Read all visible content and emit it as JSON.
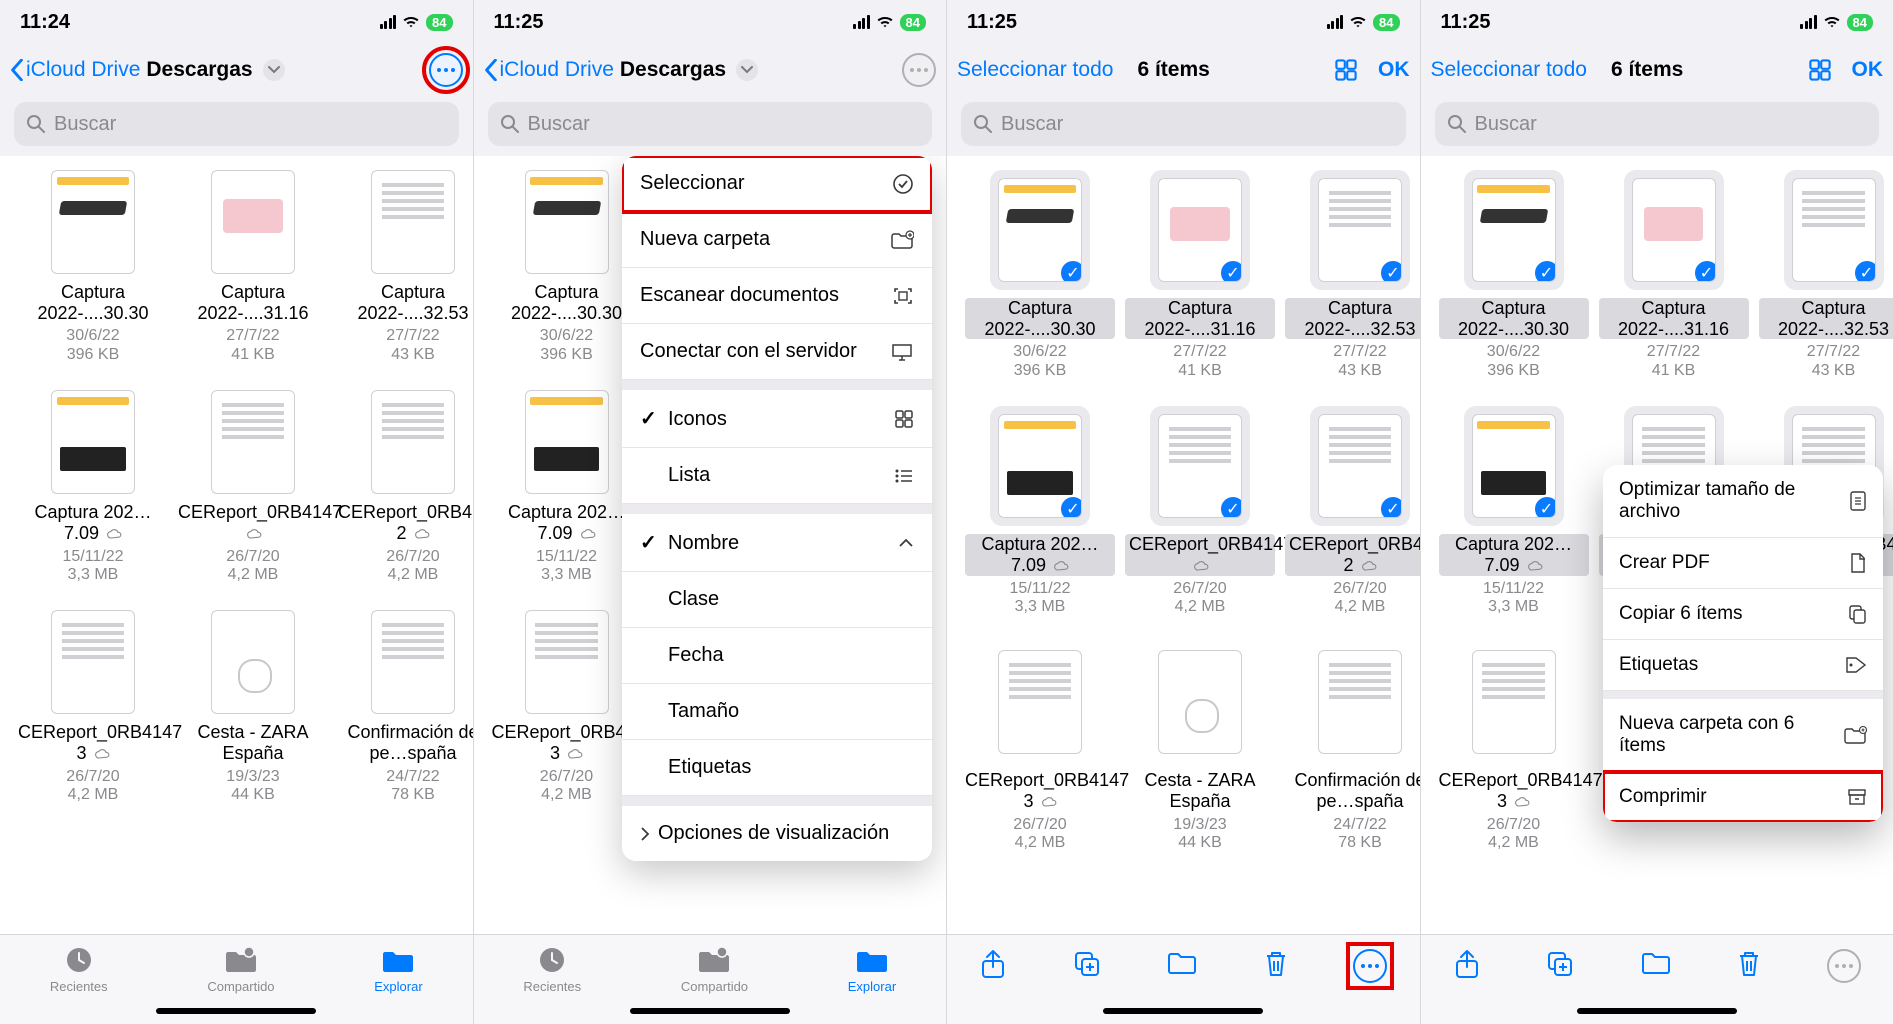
{
  "status": {
    "time1": "11:24",
    "time2": "11:25",
    "battery": "84"
  },
  "nav": {
    "back_label": "iCloud Drive",
    "folder": "Descargas",
    "select_all": "Seleccionar todo",
    "count": "6 ítems",
    "ok": "OK"
  },
  "search": {
    "placeholder": "Buscar"
  },
  "files": [
    {
      "name": "Captura 2022-....30.30",
      "date": "30/6/22",
      "size": "396 KB",
      "thumb": "hw"
    },
    {
      "name": "Captura 2022-....31.16",
      "date": "27/7/22",
      "size": "41 KB",
      "thumb": "pink"
    },
    {
      "name": "Captura 2022-....32.53",
      "date": "27/7/22",
      "size": "43 KB",
      "thumb": "blue"
    },
    {
      "name": "Captura 202…7.09",
      "date": "15/11/22",
      "size": "3,3 MB",
      "thumb": "img",
      "cloud": true
    },
    {
      "name": "CEReport_0RB4147",
      "date": "26/7/20",
      "size": "4,2 MB",
      "thumb": "doc",
      "cloud": true
    },
    {
      "name": "CEReport_0RB4147 2",
      "date": "26/7/20",
      "size": "4,2 MB",
      "thumb": "doc",
      "cloud": true
    },
    {
      "name": "CEReport_0RB4147 3",
      "date": "26/7/20",
      "size": "4,2 MB",
      "thumb": "doc",
      "cloud": true
    },
    {
      "name": "Cesta - ZARA España",
      "date": "19/3/23",
      "size": "44 KB",
      "thumb": "ring"
    },
    {
      "name": "Confirmación de pe…spaña",
      "date": "24/7/22",
      "size": "78 KB",
      "thumb": "doc"
    }
  ],
  "menu": {
    "select": "Seleccionar",
    "new_folder": "Nueva carpeta",
    "scan": "Escanear documentos",
    "connect_server": "Conectar con el servidor",
    "icons": "Iconos",
    "list": "Lista",
    "name": "Nombre",
    "class": "Clase",
    "date": "Fecha",
    "size": "Tamaño",
    "tags": "Etiquetas",
    "view_opts": "Opciones de visualización"
  },
  "ctx": {
    "optimize": "Optimizar tamaño de archivo",
    "pdf": "Crear PDF",
    "copy": "Copiar 6 ítems",
    "tags": "Etiquetas",
    "newfolder": "Nueva carpeta con 6 ítems",
    "compress": "Comprimir"
  },
  "tabs": {
    "recent": "Recientes",
    "shared": "Compartido",
    "browse": "Explorar"
  }
}
